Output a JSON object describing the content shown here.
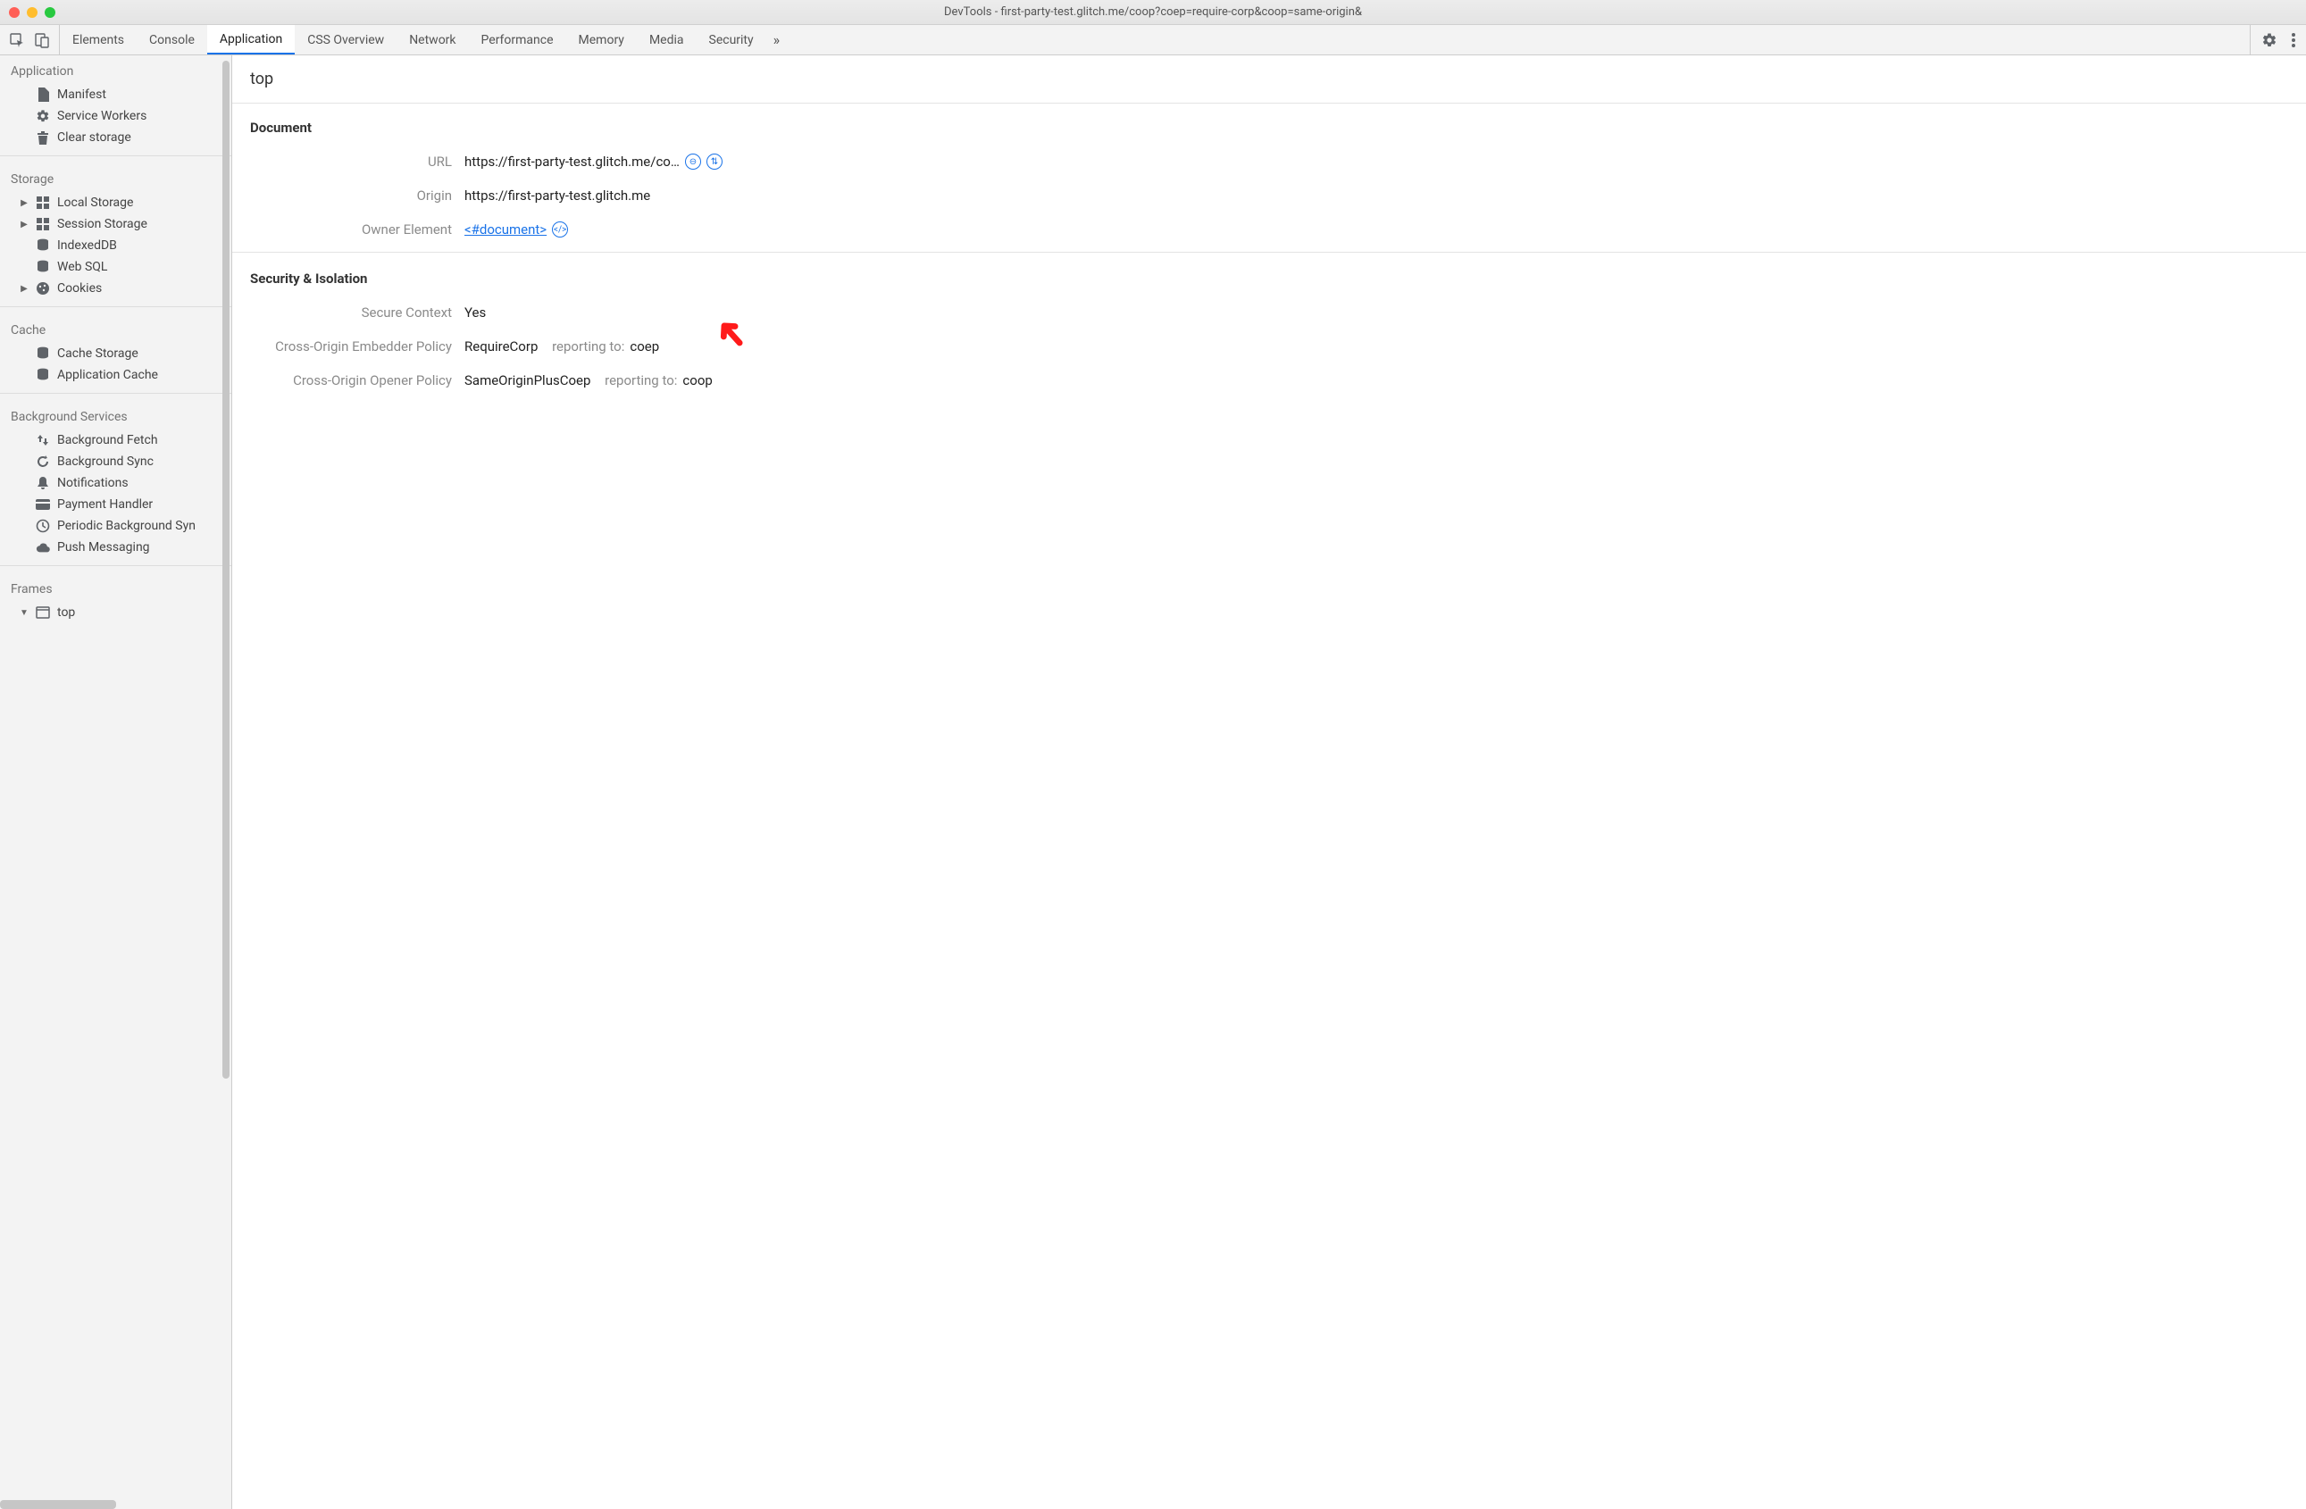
{
  "window": {
    "title": "DevTools - first-party-test.glitch.me/coop?coep=require-corp&coop=same-origin&"
  },
  "tabs": {
    "items": [
      "Elements",
      "Console",
      "Application",
      "CSS Overview",
      "Network",
      "Performance",
      "Memory",
      "Media",
      "Security"
    ],
    "active": "Application"
  },
  "sidebar": {
    "groups": [
      {
        "title": "Application",
        "items": [
          {
            "icon": "file",
            "label": "Manifest"
          },
          {
            "icon": "gear",
            "label": "Service Workers"
          },
          {
            "icon": "trash",
            "label": "Clear storage"
          }
        ]
      },
      {
        "title": "Storage",
        "items": [
          {
            "arrow": true,
            "icon": "grid",
            "label": "Local Storage"
          },
          {
            "arrow": true,
            "icon": "grid",
            "label": "Session Storage"
          },
          {
            "icon": "db",
            "label": "IndexedDB"
          },
          {
            "icon": "db",
            "label": "Web SQL"
          },
          {
            "arrow": true,
            "icon": "cookie",
            "label": "Cookies"
          }
        ]
      },
      {
        "title": "Cache",
        "items": [
          {
            "icon": "db",
            "label": "Cache Storage"
          },
          {
            "icon": "db",
            "label": "Application Cache"
          }
        ]
      },
      {
        "title": "Background Services",
        "items": [
          {
            "icon": "updown",
            "label": "Background Fetch"
          },
          {
            "icon": "sync",
            "label": "Background Sync"
          },
          {
            "icon": "bell",
            "label": "Notifications"
          },
          {
            "icon": "card",
            "label": "Payment Handler"
          },
          {
            "icon": "clock",
            "label": "Periodic Background Syn"
          },
          {
            "icon": "cloud",
            "label": "Push Messaging"
          }
        ]
      },
      {
        "title": "Frames",
        "items": [
          {
            "arrow_down": true,
            "icon": "window",
            "label": "top"
          }
        ]
      }
    ]
  },
  "content": {
    "title": "top",
    "document": {
      "heading": "Document",
      "url_label": "URL",
      "url_value": "https://first-party-test.glitch.me/co…",
      "origin_label": "Origin",
      "origin_value": "https://first-party-test.glitch.me",
      "owner_label": "Owner Element",
      "owner_value": "<#document>"
    },
    "security": {
      "heading": "Security & Isolation",
      "secure_label": "Secure Context",
      "secure_value": "Yes",
      "coep_label": "Cross-Origin Embedder Policy",
      "coep_value": "RequireCorp",
      "coep_reporting_prefix": "reporting to:",
      "coep_reporting_value": "coep",
      "coop_label": "Cross-Origin Opener Policy",
      "coop_value": "SameOriginPlusCoep",
      "coop_reporting_prefix": "reporting to:",
      "coop_reporting_value": "coop"
    }
  }
}
